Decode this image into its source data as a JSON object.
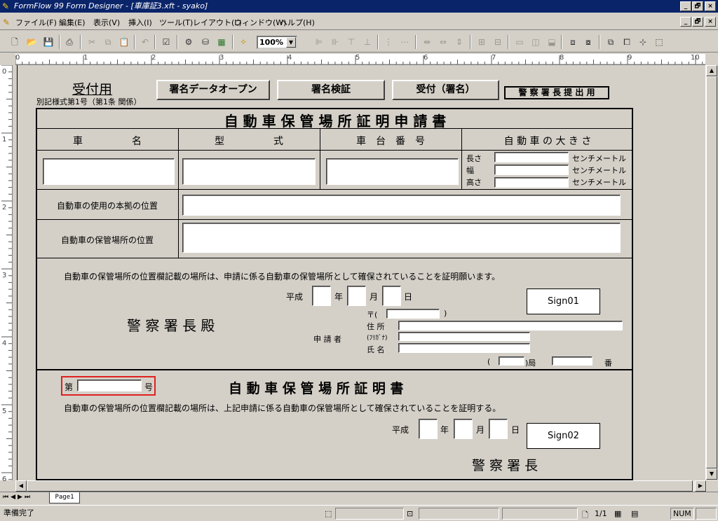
{
  "window": {
    "title": "FormFlow 99 Form Designer - [車庫証3.xft - syako]",
    "minimize": "_",
    "restore": "🗗",
    "close": "×"
  },
  "menu": {
    "items": [
      "ファイル(F)",
      "編集(E)",
      "表示(V)",
      "挿入(I)",
      "ツール(T)",
      "レイアウト(L)",
      "ウィンドウ(W)",
      "ヘルプ(H)"
    ]
  },
  "toolbar": {
    "zoom": "100%"
  },
  "ruler": {
    "h": [
      "0",
      "1",
      "2",
      "3",
      "4",
      "5",
      "6",
      "7",
      "8",
      "9",
      "10"
    ],
    "v": [
      "0",
      "1",
      "2",
      "3",
      "4",
      "5",
      "6"
    ]
  },
  "form": {
    "receipt_title": "受付用",
    "form_ref": "別記様式第1号（第1条 関係）",
    "buttons": {
      "open": "署名データオープン",
      "verify": "署名検証",
      "accept": "受付（署名）"
    },
    "police_submit": "警 察 署 長 提 出 用",
    "app_title": "自 動 車 保 管 場 所 証 明 申 請 書",
    "col_car_name": "車　　　　　名",
    "col_type": "型　　　　　式",
    "col_chassis": "車　台　番　号",
    "col_size": "自 動 車 の 大 き さ",
    "size_labels": [
      "長さ",
      "幅",
      "高さ"
    ],
    "unit": "センチメートル",
    "use_base": "自動車の使用の本拠の位置",
    "storage_loc": "自動車の保管場所の位置",
    "request_text": "自動車の保管場所の位置欄記載の場所は、申請に係る自動車の保管場所として確保されていることを証明願います。",
    "heisei": "平成",
    "year": "年",
    "month": "月",
    "day": "日",
    "police_chief_to": "警 察 署 長 殿",
    "postal": "〒(",
    "postal_close": ")",
    "address": "住 所",
    "applicant": "申 請 者",
    "furigana": "(ﾌﾘｶﾞﾅ)",
    "name": "氏 名",
    "paren": "(",
    "kyoku": ")局",
    "ban": "番",
    "sign1": "Sign01",
    "no_prefix": "第",
    "no_suffix": "号",
    "cert_title": "自 動 車 保 管 場 所 証 明 書",
    "cert_text": "自動車の保管場所の位置欄記載の場所は、上記申請に係る自動車の保管場所として確保されていることを証明する。",
    "sign2": "Sign02",
    "police_chief": "警 察 署 長"
  },
  "tabs": {
    "page1": "Page1"
  },
  "status": {
    "ready": "準備完了",
    "page": "1/1",
    "num": "NUM"
  }
}
